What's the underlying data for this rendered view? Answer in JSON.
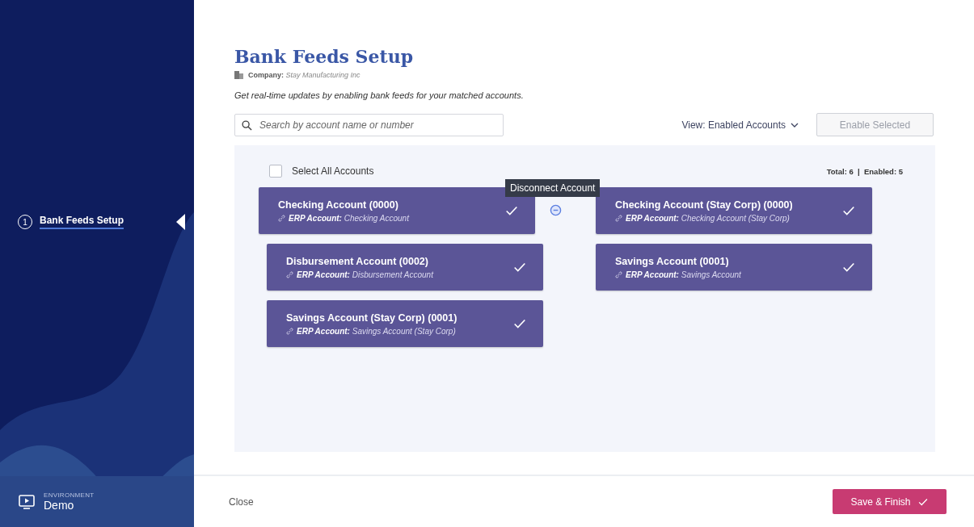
{
  "sidebar": {
    "steps": [
      {
        "number": "1",
        "label": "Bank Feeds Setup",
        "selected": true
      }
    ],
    "environment": {
      "label": "ENVIRONMENT",
      "value": "Demo"
    }
  },
  "header": {
    "title": "Bank Feeds Setup",
    "company_label": "Company:",
    "company_name": "Stay Manufacturing Inc",
    "description": "Get real-time updates by enabling bank feeds for your matched accounts."
  },
  "toolbar": {
    "search": {
      "placeholder": "Search by account name or number"
    },
    "view": "View: Enabled Accounts",
    "enable_button": {
      "label": "Enable Selected",
      "disabled": true
    }
  },
  "accounts_panel": {
    "select_all": {
      "label": "Select All Accounts",
      "checked": false
    },
    "totals": "Total: 6  |  Enabled: 5",
    "accounts": [
      {
        "name": "Checking Account (0000)",
        "erp_label": "ERP Account:",
        "erp_account": "Checking Account",
        "enabled": true,
        "hovered": true,
        "tooltip": "Disconnect Account"
      },
      {
        "name": "Checking Account (Stay Corp) (0000)",
        "erp_label": "ERP Account:",
        "erp_account": "Checking Account (Stay Corp)",
        "enabled": true,
        "hovered": false
      },
      {
        "name": "Disbursement Account (0002)",
        "erp_label": "ERP Account:",
        "erp_account": "Disbursement Account",
        "enabled": true,
        "hovered": false
      },
      {
        "name": "Savings Account (0001)",
        "erp_label": "ERP Account:",
        "erp_account": "Savings Account",
        "enabled": true,
        "hovered": false
      },
      {
        "name": "Savings Account (Stay Corp) (0001)",
        "erp_label": "ERP Account:",
        "erp_account": "Savings Account (Stay Corp)",
        "enabled": true,
        "hovered": false
      }
    ]
  },
  "footer": {
    "close": "Close",
    "save": "Save & Finish"
  }
}
